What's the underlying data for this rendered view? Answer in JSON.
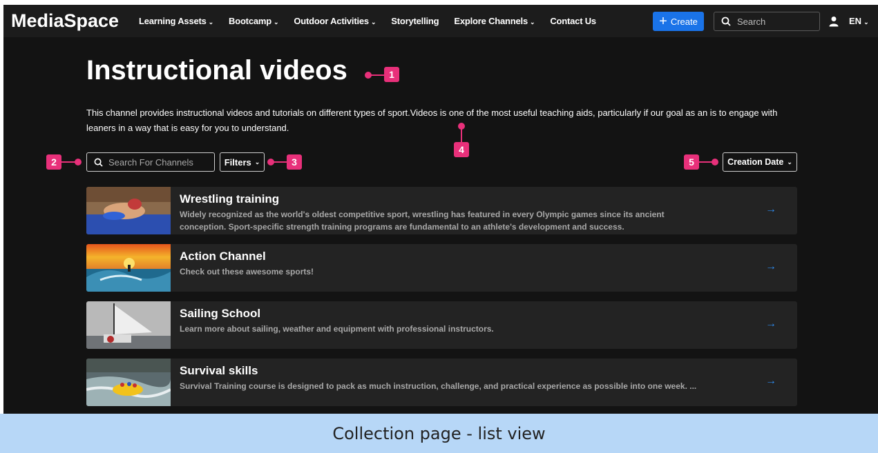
{
  "nav": {
    "logo": "MediaSpace",
    "menu": [
      {
        "label": "Learning Assets",
        "dropdown": true
      },
      {
        "label": "Bootcamp",
        "dropdown": true
      },
      {
        "label": "Outdoor Activities",
        "dropdown": true
      },
      {
        "label": "Storytelling",
        "dropdown": false
      },
      {
        "label": "Explore Channels",
        "dropdown": true
      },
      {
        "label": "Contact Us",
        "dropdown": false
      }
    ],
    "create_label": "Create",
    "search_placeholder": "Search",
    "lang": "EN"
  },
  "page": {
    "title": "Instructional videos",
    "description": "This channel provides instructional videos and tutorials on different types of sport.Videos is one of the most useful teaching aids, particularly if our goal as an is to engage with leaners in a way that is easy for you to understand.",
    "search_placeholder": "Search For Channels",
    "filters_label": "Filters",
    "sort_label": "Creation Date"
  },
  "markers": [
    "1",
    "2",
    "3",
    "4",
    "5"
  ],
  "channels": [
    {
      "title": "Wrestling training",
      "description": "Widely recognized as the world's oldest competitive sport, wrestling has featured in every Olympic games since its ancient conception. Sport-specific strength training programs are fundamental to an athlete's development and success.",
      "thumb": "wrestling-thumbnail"
    },
    {
      "title": "Action Channel",
      "description": "Check out these awesome sports!",
      "thumb": "surfing-thumbnail"
    },
    {
      "title": "Sailing School",
      "description": "Learn more about sailing, weather and equipment with professional instructors.",
      "thumb": "sailing-thumbnail"
    },
    {
      "title": "Survival skills",
      "description": "Survival Training course is designed to pack as much instruction, challenge, and practical experience as possible into one week. ...",
      "thumb": "rafting-thumbnail"
    }
  ],
  "caption": "Collection page - list view",
  "colors": {
    "accent": "#1a73e8",
    "marker": "#e8307a",
    "caption_bg": "#b7d7f7",
    "background": "#131313"
  }
}
